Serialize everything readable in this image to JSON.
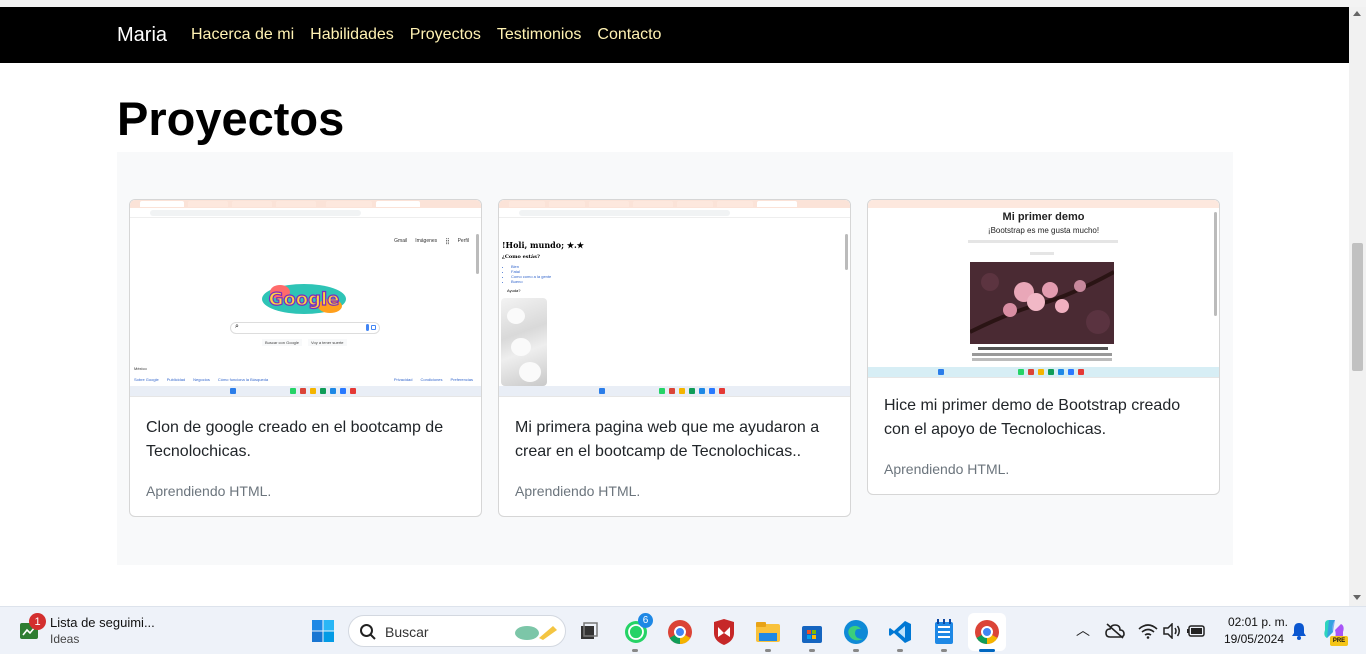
{
  "navbar": {
    "brand": "Maria",
    "links": [
      "Hacerca de mi",
      "Habilidades",
      "Proyectos",
      "Testimonios",
      "Contacto"
    ]
  },
  "section": {
    "title": "Proyectos"
  },
  "cards": [
    {
      "text": "Clon de google creado en el bootcamp de Tecnolochicas.",
      "meta": "Aprendiendo HTML.",
      "thumb": {
        "top_links": [
          "Gmail",
          "Imágenes",
          "Perfil"
        ],
        "logo": "Google",
        "buttons": [
          "Buscar con Google",
          "Voy a tener suerte"
        ],
        "country": "México",
        "footer_left": [
          "Sobre Google",
          "Publicidad",
          "Negocios",
          "Cómo funciona la Búsqueda"
        ],
        "footer_right": [
          "Privacidad",
          "Condiciones",
          "Preferencias"
        ]
      }
    },
    {
      "text": "Mi primera pagina web que me ayudaron a crear en el bootcamp de Tecnolochicas..",
      "meta": "Aprendiendo HTML.",
      "thumb": {
        "heading": "!Holi, mundo; ★.★",
        "subheading": "¿Como estás?",
        "list": [
          "Bien",
          "Fatal",
          "Como como a la gente",
          "Bueno"
        ],
        "question": "Ayuda?"
      }
    },
    {
      "text": "Hice mi primer demo de Bootstrap creado con el apoyo de Tecnolochicas.",
      "meta": "Aprendiendo HTML.",
      "thumb": {
        "title": "Mi primer demo",
        "subtitle": "¡Bootstrap es me gusta mucho!"
      }
    }
  ],
  "taskbar": {
    "widget_title": "Lista de seguimi...",
    "widget_subtitle": "Ideas",
    "widget_badge": "1",
    "search_placeholder": "Buscar",
    "whatsapp_badge": "6",
    "time": "02:01 p. m.",
    "date": "19/05/2024",
    "copilot_badge": "PRE"
  },
  "colors": {
    "navbar_bg": "#000000",
    "nav_link": "#fff2b3",
    "section_bg": "#f8f9fa"
  }
}
